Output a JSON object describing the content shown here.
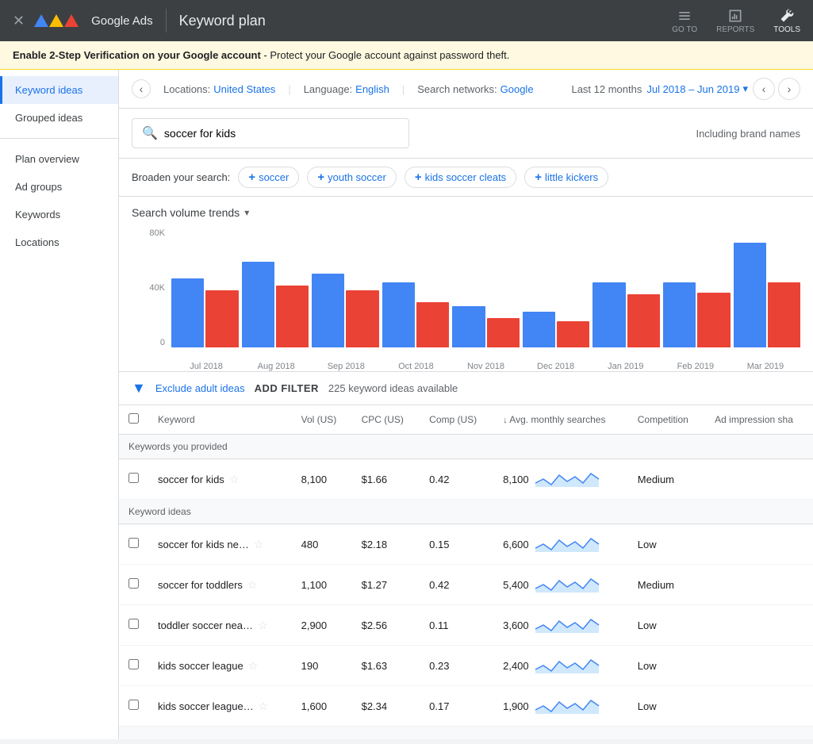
{
  "app": {
    "title": "Keyword plan",
    "brand": "Google Ads"
  },
  "topnav": {
    "close_icon": "×",
    "actions": [
      {
        "label": "GO TO",
        "icon": "goto"
      },
      {
        "label": "REPORTS",
        "icon": "reports"
      },
      {
        "label": "TOOLS",
        "icon": "tools",
        "active": true
      }
    ]
  },
  "notification": {
    "bold_text": "Enable 2-Step Verification on your Google account",
    "regular_text": " - Protect your Google account against password theft."
  },
  "sidebar": {
    "items": [
      {
        "label": "Keyword ideas",
        "active": true
      },
      {
        "label": "Grouped ideas",
        "active": false
      },
      {
        "label": "Plan overview",
        "active": false
      },
      {
        "label": "Ad groups",
        "active": false
      },
      {
        "label": "Keywords",
        "active": false
      },
      {
        "label": "Locations",
        "active": false
      }
    ]
  },
  "filter_bar": {
    "location_label": "Locations:",
    "location_value": "United States",
    "language_label": "Language:",
    "language_value": "English",
    "network_label": "Search networks:",
    "network_value": "Google",
    "date_label": "Last 12 months",
    "date_range": "Jul 2018 – Jun 2019"
  },
  "search": {
    "value": "soccer for kids",
    "brand_text": "Including brand names"
  },
  "broaden": {
    "label": "Broaden your search:",
    "chips": [
      {
        "text": "soccer"
      },
      {
        "text": "youth soccer"
      },
      {
        "text": "kids soccer cleats"
      },
      {
        "text": "little kickers"
      }
    ]
  },
  "chart": {
    "title": "Search volume trends",
    "y_labels": [
      "80K",
      "40K",
      "0"
    ],
    "bars": [
      {
        "label": "Jul 2018",
        "blue": 0.58,
        "red": 0.48
      },
      {
        "label": "Aug 2018",
        "blue": 0.72,
        "red": 0.52
      },
      {
        "label": "Sep 2018",
        "blue": 0.62,
        "red": 0.48
      },
      {
        "label": "Oct 2018",
        "blue": 0.55,
        "red": 0.38
      },
      {
        "label": "Nov 2018",
        "blue": 0.35,
        "red": 0.25
      },
      {
        "label": "Dec 2018",
        "blue": 0.3,
        "red": 0.22
      },
      {
        "label": "Jan 2019",
        "blue": 0.55,
        "red": 0.45
      },
      {
        "label": "Feb 2019",
        "blue": 0.55,
        "red": 0.46
      },
      {
        "label": "Mar 2019",
        "blue": 0.88,
        "red": 0.55
      }
    ]
  },
  "filter_row": {
    "exclude_link": "Exclude adult ideas",
    "add_filter": "ADD FILTER",
    "count_text": "225 keyword ideas available"
  },
  "table": {
    "columns": [
      {
        "label": "Keyword",
        "sortable": false
      },
      {
        "label": "Vol (US)",
        "sortable": false
      },
      {
        "label": "CPC (US)",
        "sortable": false
      },
      {
        "label": "Comp (US)",
        "sortable": false
      },
      {
        "label": "Avg. monthly searches",
        "sortable": true,
        "sort_dir": "desc"
      },
      {
        "label": "Competition",
        "sortable": false
      },
      {
        "label": "Ad impression sha",
        "sortable": false
      }
    ],
    "sections": [
      {
        "header": "Keywords you provided",
        "rows": [
          {
            "keyword": "soccer for kids",
            "vol": "8,100",
            "cpc": "$1.66",
            "comp": "0.42",
            "avg": "8,100",
            "competition": "Medium"
          }
        ]
      },
      {
        "header": "Keyword ideas",
        "rows": [
          {
            "keyword": "soccer for kids ne…",
            "vol": "480",
            "cpc": "$2.18",
            "comp": "0.15",
            "avg": "6,600",
            "competition": "Low"
          },
          {
            "keyword": "soccer for toddlers",
            "vol": "1,100",
            "cpc": "$1.27",
            "comp": "0.42",
            "avg": "5,400",
            "competition": "Medium"
          },
          {
            "keyword": "toddler soccer nea…",
            "vol": "2,900",
            "cpc": "$2.56",
            "comp": "0.11",
            "avg": "3,600",
            "competition": "Low"
          },
          {
            "keyword": "kids soccer league",
            "vol": "190",
            "cpc": "$1.63",
            "comp": "0.23",
            "avg": "2,400",
            "competition": "Low"
          },
          {
            "keyword": "kids soccer league…",
            "vol": "1,600",
            "cpc": "$2.34",
            "comp": "0.17",
            "avg": "1,900",
            "competition": "Low"
          }
        ]
      }
    ]
  }
}
